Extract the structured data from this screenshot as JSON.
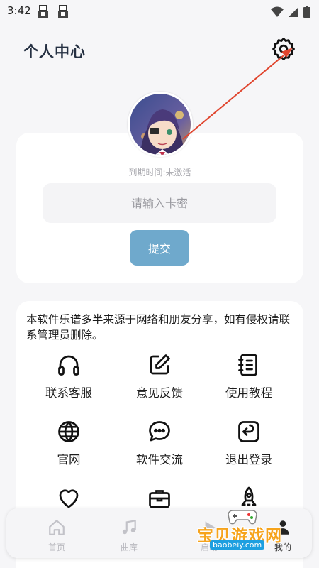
{
  "status_bar": {
    "time": "3:42"
  },
  "header": {
    "title": "个人中心",
    "settings_icon": "gear-icon"
  },
  "profile": {
    "expiry": "到期时间:未激活",
    "card_key_placeholder": "请输入卡密",
    "submit_label": "提交"
  },
  "notice": "本软件乐谱多半来源于网络和朋友分享，如有侵权请联系管理员删除。",
  "menu": [
    {
      "label": "联系客服",
      "icon": "headphones-icon"
    },
    {
      "label": "意见反馈",
      "icon": "pencil-square-icon"
    },
    {
      "label": "使用教程",
      "icon": "notebook-icon"
    },
    {
      "label": "官网",
      "icon": "globe-icon"
    },
    {
      "label": "软件交流",
      "icon": "chat-bubble-icon"
    },
    {
      "label": "退出登录",
      "icon": "logout-icon"
    },
    {
      "label": "",
      "icon": "heart-icon"
    },
    {
      "label": "",
      "icon": "briefcase-icon"
    },
    {
      "label": "",
      "icon": "rocket-icon"
    }
  ],
  "bottom_nav": [
    {
      "label": "首页",
      "icon": "home-icon"
    },
    {
      "label": "曲库",
      "icon": "music-note-icon"
    },
    {
      "label": "启动",
      "icon": "play-icon"
    },
    {
      "label": "我的",
      "icon": "user-icon"
    }
  ],
  "watermark": {
    "text": "宝贝游戏网",
    "url": "baobeiy.com"
  },
  "colors": {
    "accent": "#6fa9cc",
    "background": "#f6f6f8",
    "annotation": "#e0452e"
  }
}
